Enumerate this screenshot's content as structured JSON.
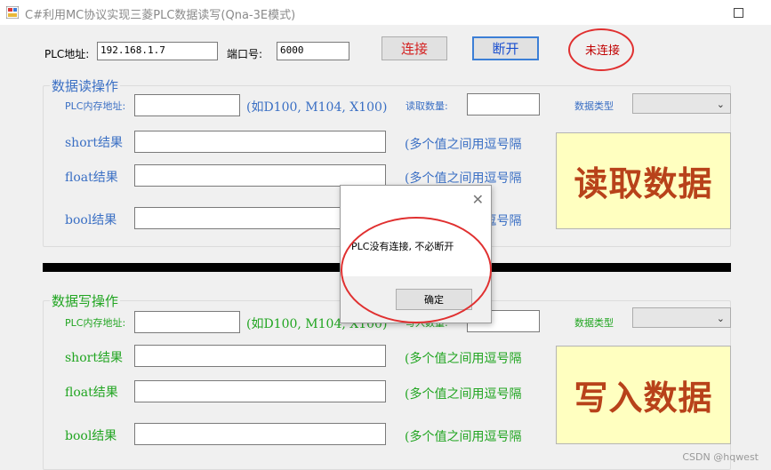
{
  "window": {
    "title": "C#利用MC协议实现三菱PLC数据读写(Qna-3E模式)"
  },
  "connection": {
    "ip_label": "PLC地址:",
    "ip_value": "192.168.1.7",
    "port_label": "端口号:",
    "port_value": "6000",
    "connect_button": "连接",
    "disconnect_button": "断开",
    "status_text": "未连接"
  },
  "read_section": {
    "title": "数据读操作",
    "address_label": "PLC内存地址:",
    "address_hint": "(如D100, M104, X100)",
    "count_label": "读取数量:",
    "type_label": "数据类型",
    "short_label": "short结果",
    "short_hint": "(多个值之间用逗号隔",
    "float_label": "float结果",
    "float_hint": "(多个值之间用逗号隔",
    "bool_label": "bool结果",
    "bool_hint": "(多个值之间用逗号隔",
    "action_button": "读取数据"
  },
  "write_section": {
    "title": "数据写操作",
    "address_label": "PLC内存地址:",
    "address_hint": "(如D100, M104, X100)",
    "count_label": "写入数量:",
    "type_label": "数据类型",
    "short_label": "short结果",
    "short_hint": "(多个值之间用逗号隔",
    "float_label": "float结果",
    "float_hint": "(多个值之间用逗号隔",
    "bool_label": "bool结果",
    "bool_hint": "(多个值之间用逗号隔",
    "action_button": "写入数据"
  },
  "dialog": {
    "message": "PLC没有连接, 不必断开",
    "ok_button": "确定"
  },
  "watermark": "CSDN @hqwest",
  "icons": {
    "app": "app-icon",
    "maximize": "maximize-icon",
    "close": "close-icon",
    "dropdown": "chevron-down-icon"
  },
  "colors": {
    "read_accent": "#3a6fc4",
    "write_accent": "#21a521",
    "connect_text": "#d42020",
    "disconnect_text": "#1a4fcf",
    "status_text": "#c00000",
    "big_button_bg": "#ffffc0",
    "big_button_text": "#b8421a",
    "annotation_circle": "#e03030"
  }
}
